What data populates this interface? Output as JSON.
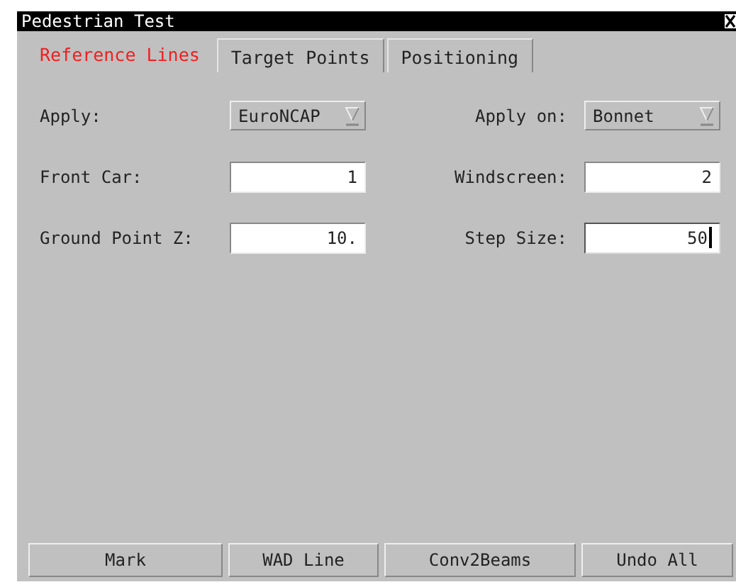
{
  "window": {
    "title": "Pedestrian Test"
  },
  "tabs": [
    {
      "label": "Reference Lines",
      "selected": true
    },
    {
      "label": "Target Points",
      "selected": false
    },
    {
      "label": "Positioning",
      "selected": false
    }
  ],
  "rows": [
    {
      "left": {
        "label": "Apply:",
        "kind": "dropdown",
        "value": "EuroNCAP"
      },
      "right": {
        "label": "Apply on:",
        "kind": "dropdown",
        "value": "Bonnet"
      }
    },
    {
      "left": {
        "label": "Front Car:",
        "kind": "field",
        "value": "1",
        "focused": false
      },
      "right": {
        "label": "Windscreen:",
        "kind": "field",
        "value": "2",
        "focused": false
      }
    },
    {
      "left": {
        "label": "Ground Point Z:",
        "kind": "field",
        "value": "10.",
        "focused": false
      },
      "right": {
        "label": "Step Size:",
        "kind": "field",
        "value": "50",
        "focused": true
      }
    }
  ],
  "buttons": [
    "Mark",
    "WAD Line",
    "Conv2Beams",
    "Undo All"
  ]
}
